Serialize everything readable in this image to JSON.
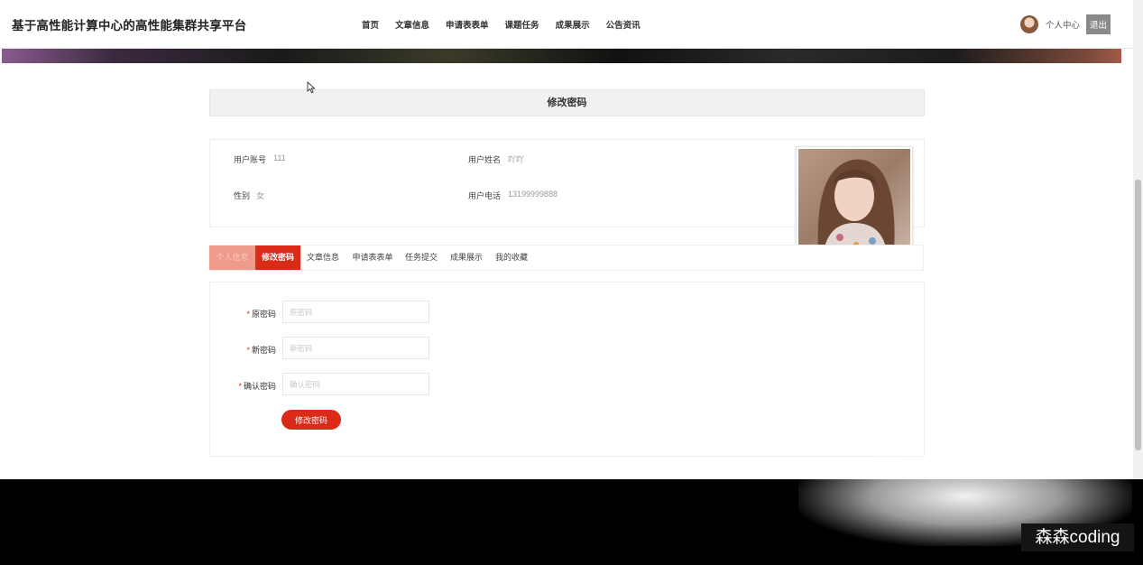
{
  "header": {
    "site_title": "基于高性能计算中心的高性能集群共享平台",
    "nav": [
      "首页",
      "文章信息",
      "申请表表单",
      "课题任务",
      "成果展示",
      "公告资讯"
    ],
    "personal_center": "个人中心",
    "logout": "退出"
  },
  "page": {
    "title": "修改密码"
  },
  "profile": {
    "account_label": "用户账号",
    "account_value": "111",
    "name_label": "用户姓名",
    "name_value": "吖吖",
    "gender_label": "性别",
    "gender_value": "女",
    "phone_label": "用户电话",
    "phone_value": "13199999888"
  },
  "tabs": [
    "个人信息",
    "修改密码",
    "文章信息",
    "申请表表单",
    "任务提交",
    "成果展示",
    "我的收藏"
  ],
  "active_tab": "修改密码",
  "form": {
    "required_mark": "*",
    "old_label": "原密码",
    "old_placeholder": "原密码",
    "new_label": "新密码",
    "new_placeholder": "新密码",
    "confirm_label": "确认密码",
    "confirm_placeholder": "确认密码",
    "submit": "修改密码"
  },
  "watermark": "森森coding",
  "colors": {
    "accent": "#d92b18",
    "accent_faded": "#ee9b8c",
    "title_bar": "#f1f1f1",
    "logout_bg": "#8a8a8a"
  }
}
